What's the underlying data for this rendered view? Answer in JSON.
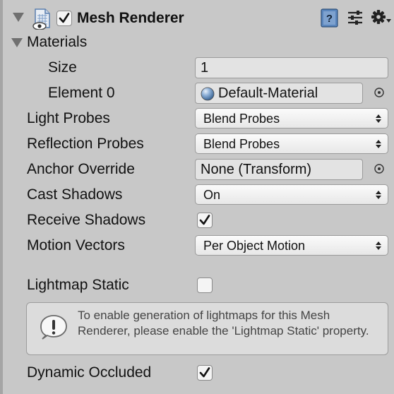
{
  "header": {
    "title": "Mesh Renderer",
    "enabled": true
  },
  "materials": {
    "label": "Materials",
    "size_label": "Size",
    "size_value": "1",
    "element_label": "Element 0",
    "element_value": "Default-Material"
  },
  "properties": {
    "light_probes": {
      "label": "Light Probes",
      "value": "Blend Probes"
    },
    "reflection_probes": {
      "label": "Reflection Probes",
      "value": "Blend Probes"
    },
    "anchor_override": {
      "label": "Anchor Override",
      "value": "None (Transform)"
    },
    "cast_shadows": {
      "label": "Cast Shadows",
      "value": "On"
    },
    "receive_shadows": {
      "label": "Receive Shadows",
      "checked": true
    },
    "motion_vectors": {
      "label": "Motion Vectors",
      "value": "Per Object Motion"
    },
    "lightmap_static": {
      "label": "Lightmap Static",
      "checked": false
    },
    "dynamic_occluded": {
      "label": "Dynamic Occluded",
      "checked": true
    }
  },
  "help_box": {
    "text": "To enable generation of lightmaps for this Mesh Renderer, please enable the 'Lightmap Static' property."
  },
  "icons": {
    "foldout": "foldout-triangle-icon",
    "component": "mesh-renderer-icon",
    "help": "help-book-icon",
    "presets": "presets-icon",
    "settings": "gear-icon",
    "picker": "object-picker-icon",
    "info": "info-exclamation-icon",
    "material": "material-sphere-icon"
  },
  "colors": {
    "background": "#c8c8c8",
    "field": "#e3e3e3",
    "checkbox_tick": "#111111",
    "help_icon_blue": "#4f7fb8"
  }
}
